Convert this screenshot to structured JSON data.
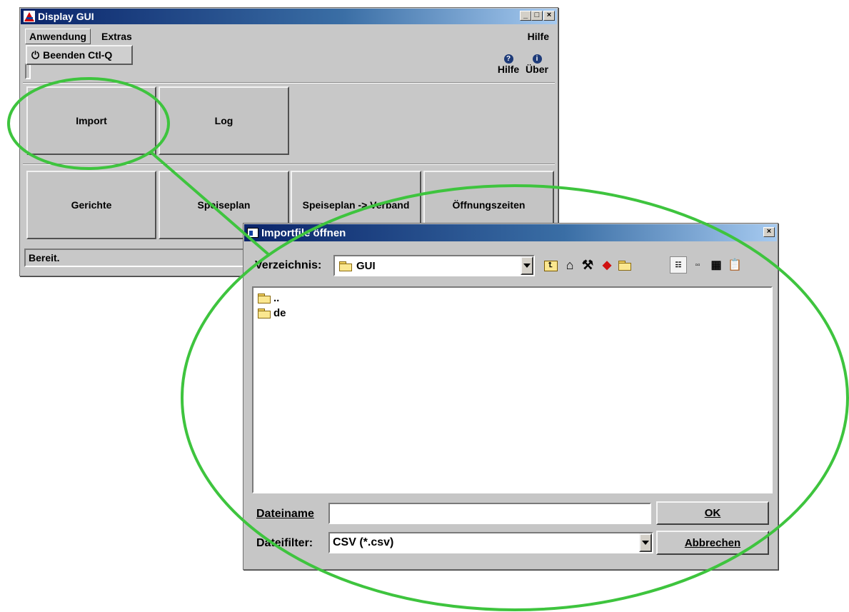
{
  "main_window": {
    "title": "Display GUI",
    "menu": {
      "anwendung": "Anwendung",
      "extras": "Extras",
      "hilfe": "Hilfe"
    },
    "dropdown_item": "Beenden Ctl-Q",
    "toolbar": {
      "help_label": "Hilfe",
      "about_label": "Über"
    },
    "buttons": {
      "import": "Import",
      "log": "Log",
      "gerichte": "Gerichte",
      "speiseplan": "Speiseplan",
      "speiseplan_verband": "Speiseplan -> Verband",
      "oeffnungszeiten": "Öffnungszeiten"
    },
    "status": "Bereit."
  },
  "dialog": {
    "title": "Importfile öffnen",
    "directory_label": "Verzeichnis:",
    "directory_value": "GUI",
    "files": [
      {
        "name": ".."
      },
      {
        "name": "de"
      }
    ],
    "filename_label": "Dateiname",
    "filename_value": "",
    "filter_label": "Dateifilter:",
    "filter_value": "CSV (*.csv)",
    "ok_label": "OK",
    "cancel_label": "Abbrechen"
  },
  "colors": {
    "highlight_ellipse": "#3ec43e",
    "titlebar": "#0a246a"
  }
}
